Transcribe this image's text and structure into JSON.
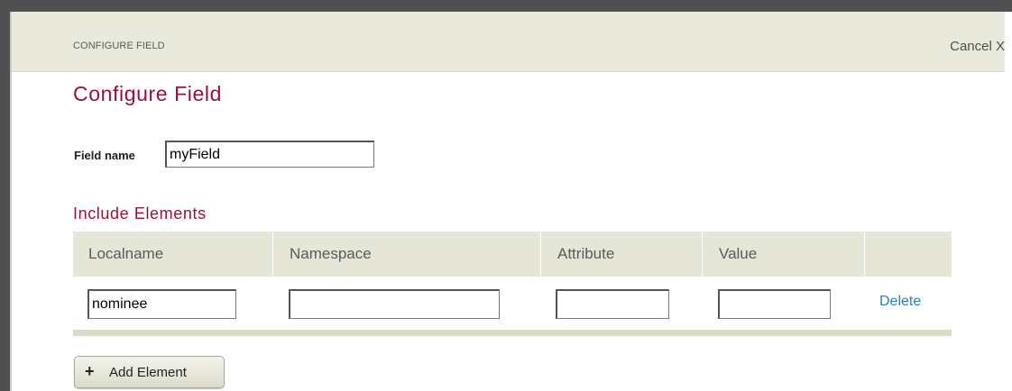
{
  "dialog": {
    "header_title": "CONFIGURE FIELD",
    "cancel_label": "Cancel X"
  },
  "main": {
    "page_title": "Configure Field",
    "field_name_label": "Field name",
    "field_name_value": "myField",
    "section_title": "Include Elements",
    "table": {
      "columns": [
        "Localname",
        "Namespace",
        "Attribute",
        "Value",
        ""
      ],
      "rows": [
        {
          "localname": "nominee",
          "namespace": "",
          "attribute": "",
          "value": "",
          "action_label": "Delete"
        }
      ]
    },
    "add_element_label": "Add Element",
    "add_element_icon": "+"
  },
  "colors": {
    "accent": "#9a0f3e",
    "link": "#2a7fc4",
    "header_bg": "#e9eadb",
    "table_header_bg": "#e5e6d7"
  }
}
